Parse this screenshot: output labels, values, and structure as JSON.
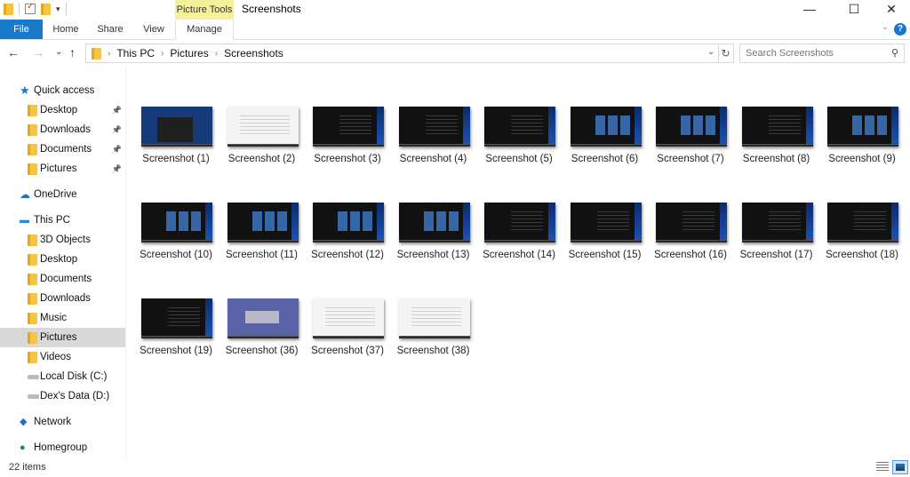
{
  "window": {
    "title": "Screenshots",
    "contextual_tab_group": "Picture Tools",
    "controls": {
      "minimize": "—",
      "maximize": "☐",
      "close": "✕"
    }
  },
  "ribbon": {
    "tabs": [
      {
        "label": "File",
        "active": false
      },
      {
        "label": "Home",
        "active": false
      },
      {
        "label": "Share",
        "active": false
      },
      {
        "label": "View",
        "active": false
      },
      {
        "label": "Manage",
        "active": false
      }
    ],
    "help_label": "?",
    "collapse_glyph": "⌄"
  },
  "navigation": {
    "back_glyph": "←",
    "forward_glyph": "→",
    "recent_glyph": "⌄",
    "up_glyph": "↑",
    "breadcrumb": [
      "This PC",
      "Pictures",
      "Screenshots"
    ],
    "refresh_glyph": "↻",
    "search_placeholder": "Search Screenshots",
    "search_glyph": "⚲"
  },
  "sidebar": {
    "items": [
      {
        "label": "Quick access",
        "icon": "star-icon",
        "level": 0,
        "pinned": false,
        "selected": false
      },
      {
        "label": "Desktop",
        "icon": "desktop-folder-icon",
        "level": 1,
        "pinned": true,
        "selected": false
      },
      {
        "label": "Downloads",
        "icon": "downloads-folder-icon",
        "level": 1,
        "pinned": true,
        "selected": false
      },
      {
        "label": "Documents",
        "icon": "documents-folder-icon",
        "level": 1,
        "pinned": true,
        "selected": false
      },
      {
        "label": "Pictures",
        "icon": "pictures-folder-icon",
        "level": 1,
        "pinned": true,
        "selected": false
      },
      {
        "label": "OneDrive",
        "icon": "cloud-icon",
        "level": 0,
        "pinned": false,
        "selected": false
      },
      {
        "label": "This PC",
        "icon": "computer-icon",
        "level": 0,
        "pinned": false,
        "selected": false
      },
      {
        "label": "3D Objects",
        "icon": "3d-objects-folder-icon",
        "level": 1,
        "pinned": false,
        "selected": false
      },
      {
        "label": "Desktop",
        "icon": "desktop-folder-icon",
        "level": 1,
        "pinned": false,
        "selected": false
      },
      {
        "label": "Documents",
        "icon": "documents-folder-icon",
        "level": 1,
        "pinned": false,
        "selected": false
      },
      {
        "label": "Downloads",
        "icon": "downloads-folder-icon",
        "level": 1,
        "pinned": false,
        "selected": false
      },
      {
        "label": "Music",
        "icon": "music-folder-icon",
        "level": 1,
        "pinned": false,
        "selected": false
      },
      {
        "label": "Pictures",
        "icon": "pictures-folder-icon",
        "level": 1,
        "pinned": false,
        "selected": true
      },
      {
        "label": "Videos",
        "icon": "videos-folder-icon",
        "level": 1,
        "pinned": false,
        "selected": false
      },
      {
        "label": "Local Disk (C:)",
        "icon": "windows-drive-icon",
        "level": 1,
        "pinned": false,
        "selected": false
      },
      {
        "label": "Dex's Data (D:)",
        "icon": "drive-icon",
        "level": 1,
        "pinned": false,
        "selected": false
      },
      {
        "label": "Network",
        "icon": "network-icon",
        "level": 0,
        "pinned": false,
        "selected": false
      },
      {
        "label": "Homegroup",
        "icon": "homegroup-icon",
        "level": 0,
        "pinned": false,
        "selected": false
      }
    ]
  },
  "files": [
    {
      "name": "Screenshot (1)",
      "thumb": "desk"
    },
    {
      "name": "Screenshot (2)",
      "thumb": "light"
    },
    {
      "name": "Screenshot (3)",
      "thumb": "dark-text"
    },
    {
      "name": "Screenshot (4)",
      "thumb": "dark-text"
    },
    {
      "name": "Screenshot (5)",
      "thumb": "dark-text"
    },
    {
      "name": "Screenshot (6)",
      "thumb": "dark-boxes"
    },
    {
      "name": "Screenshot (7)",
      "thumb": "dark-boxes"
    },
    {
      "name": "Screenshot (8)",
      "thumb": "dark-text"
    },
    {
      "name": "Screenshot (9)",
      "thumb": "dark-boxes"
    },
    {
      "name": "Screenshot (10)",
      "thumb": "dark-boxes"
    },
    {
      "name": "Screenshot (11)",
      "thumb": "dark-boxes"
    },
    {
      "name": "Screenshot (12)",
      "thumb": "dark-boxes"
    },
    {
      "name": "Screenshot (13)",
      "thumb": "dark-boxes"
    },
    {
      "name": "Screenshot (14)",
      "thumb": "dark-text"
    },
    {
      "name": "Screenshot (15)",
      "thumb": "dark-text"
    },
    {
      "name": "Screenshot (16)",
      "thumb": "dark-text"
    },
    {
      "name": "Screenshot (17)",
      "thumb": "dark-text"
    },
    {
      "name": "Screenshot (18)",
      "thumb": "dark-text"
    },
    {
      "name": "Screenshot (19)",
      "thumb": "dark-text"
    },
    {
      "name": "Screenshot (36)",
      "thumb": "cad"
    },
    {
      "name": "Screenshot (37)",
      "thumb": "light"
    },
    {
      "name": "Screenshot (38)",
      "thumb": "light"
    }
  ],
  "status": {
    "item_count": "22 items"
  }
}
